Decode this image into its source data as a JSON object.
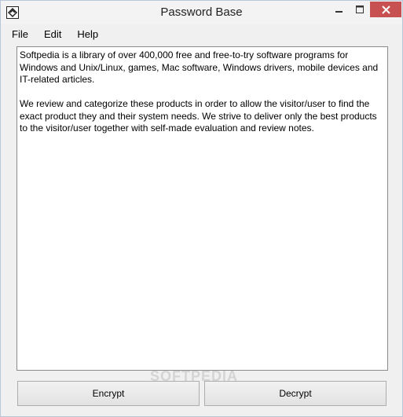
{
  "window": {
    "title": "Password Base"
  },
  "menu": {
    "items": [
      "File",
      "Edit",
      "Help"
    ]
  },
  "content": {
    "paragraph1": "Softpedia is a library of over 400,000 free and free-to-try software programs for Windows and Unix/Linux, games, Mac software, Windows drivers, mobile devices and IT-related articles.",
    "paragraph2": "We review and categorize these products in order to allow the visitor/user to find the exact product they and their system needs. We strive to deliver only the best products to the visitor/user together with self-made evaluation and review notes."
  },
  "buttons": {
    "encrypt": "Encrypt",
    "decrypt": "Decrypt"
  },
  "watermark": "SOFTPEDIA",
  "colors": {
    "close_button": "#c75050"
  },
  "icons": {
    "app": "app-icon",
    "minimize": "minimize-icon",
    "maximize": "maximize-icon",
    "close": "close-icon"
  }
}
